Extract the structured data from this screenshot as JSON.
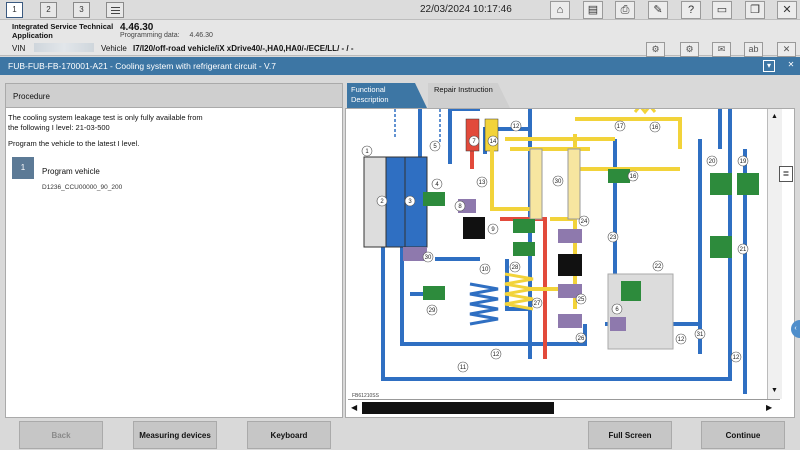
{
  "tabs": [
    "1",
    "2",
    "3"
  ],
  "datetime": "22/03/2024 10:17:46",
  "header": {
    "app_name": "Integrated Service Technical Application",
    "version": "4.46.30",
    "programming_label": "Programming data:",
    "programming_value": "4.46.30",
    "vin_label": "VIN",
    "vehicle_label": "Vehicle",
    "vehicle_value": "I7/I20/off-road vehicle/iX xDrive40/-,HA0,HA0/-/ECE/LL/ - / -"
  },
  "window": {
    "title": "FUB-FUB-FB-170001-A21 - Cooling system with refrigerant circuit - V.7"
  },
  "procedure": {
    "tab_label": "Procedure",
    "intro_line1": "The cooling system leakage test is only fully available from",
    "intro_line2": "the following I level: 21-03-500",
    "instruction": "Program the vehicle to the latest I level.",
    "step_number": "1",
    "step_title": "Program vehicle",
    "step_code": "D1236_CCU00000_90_200"
  },
  "right_tabs": {
    "functional": "Functional Description",
    "repair": "Repair Instruction"
  },
  "diagram": {
    "figure_id": "FB61210SS",
    "callouts": [
      "1",
      "2",
      "3",
      "4",
      "5",
      "6",
      "7",
      "8",
      "9",
      "10",
      "11",
      "12",
      "13",
      "14",
      "16",
      "17",
      "18",
      "19",
      "20",
      "21",
      "22",
      "23",
      "24",
      "25",
      "26",
      "27",
      "28",
      "29",
      "30",
      "31"
    ],
    "colors": {
      "cold_coolant": "#2f6fc2",
      "hot_coolant": "#e24a3b",
      "refrigerant": "#f2d33a",
      "component_purple": "#8e79ad",
      "component_green": "#2d8b3c"
    }
  },
  "buttons": {
    "back": "Back",
    "measuring": "Measuring devices",
    "keyboard": "Keyboard",
    "fullscreen": "Full Screen",
    "continue": "Continue"
  }
}
